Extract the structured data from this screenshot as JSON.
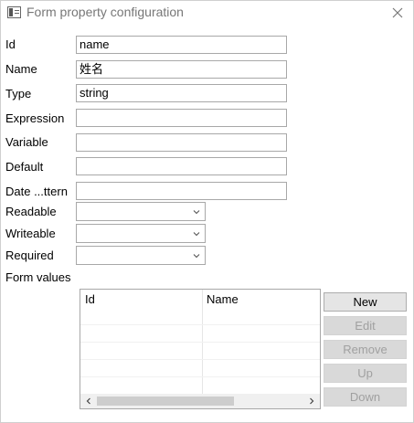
{
  "window": {
    "title": "Form property configuration",
    "icon": "window-icon",
    "close_icon": "close-icon"
  },
  "fields": {
    "id_label": "Id",
    "id_value": "name",
    "name_label": "Name",
    "name_value": "姓名",
    "type_label": "Type",
    "type_value": "string",
    "expression_label": "Expression",
    "expression_value": "",
    "variable_label": "Variable",
    "variable_value": "",
    "default_label": "Default",
    "default_value": "",
    "datepattern_label": "Date ...ttern",
    "datepattern_value": "",
    "readable_label": "Readable",
    "readable_value": "",
    "writeable_label": "Writeable",
    "writeable_value": "",
    "required_label": "Required",
    "required_value": ""
  },
  "form_values": {
    "label": "Form values",
    "columns": [
      "Id",
      "Name"
    ],
    "rows": []
  },
  "buttons": {
    "new": "New",
    "edit": "Edit",
    "remove": "Remove",
    "up": "Up",
    "down": "Down"
  }
}
